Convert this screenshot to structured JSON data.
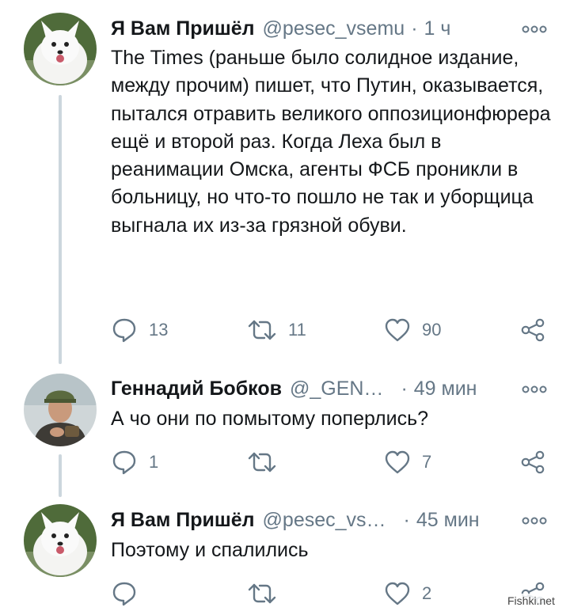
{
  "tweets": [
    {
      "name": "Я Вам Пришёл",
      "handle": "@pesec_vsemu",
      "separator": "·",
      "time": "1 ч",
      "text": "The Times (раньше было солидное издание, между прочим) пишет, что Путин, оказывается, пытался отравить великого оппозиционфюрера ещё и второй раз. Когда Леха был в реанимации Омска, агенты ФСБ проникли в больницу, но что-то пошло не так и уборщица выгнала их из-за грязной обуви.",
      "replies": "13",
      "retweets": "11",
      "likes": "90",
      "avatar": "arctic-fox-avatar"
    },
    {
      "name": "Геннадий Бобков",
      "handle": "@_GEN…",
      "separator": "·",
      "time": "49 мин",
      "text": "А чо они по помытому поперлись?",
      "replies": "1",
      "retweets": "",
      "likes": "7",
      "avatar": "soldier-photo-avatar"
    },
    {
      "name": "Я Вам Пришёл",
      "handle": "@pesec_vs…",
      "separator": "·",
      "time": "45 мин",
      "text": "Поэтому и спалились",
      "replies": "",
      "retweets": "",
      "likes": "2",
      "avatar": "arctic-fox-avatar"
    }
  ],
  "watermark": "Fishki.net",
  "colors": {
    "text": "#14171a",
    "secondary": "#657786",
    "thread_line": "#ccd6dd",
    "icon": "#657786"
  },
  "icons": [
    "reply-icon",
    "retweet-icon",
    "like-icon",
    "share-icon",
    "more-options-icon"
  ]
}
